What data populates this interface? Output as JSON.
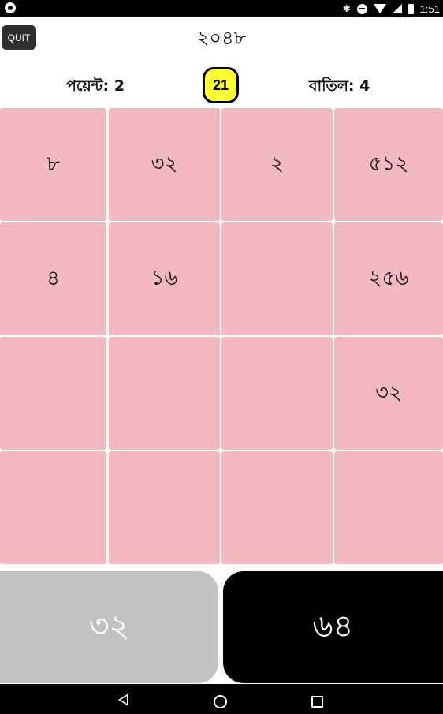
{
  "status_bar": {
    "time": "1:51",
    "icons": [
      "app-notification-icon",
      "bluetooth-icon",
      "do-not-disturb-icon",
      "wifi-icon",
      "cellular-icon",
      "battery-icon"
    ]
  },
  "header": {
    "quit_label": "QUIT",
    "title": "২০৪৮"
  },
  "score": {
    "points_label": "পয়েন্ট: 2",
    "counter": "21",
    "discard_label": "বাতিল: 4"
  },
  "board": {
    "rows": [
      [
        "৮",
        "৩২",
        "২",
        "৫১২"
      ],
      [
        "৪",
        "১৬",
        "",
        "২৫৬"
      ],
      [
        "",
        "",
        "",
        "৩২"
      ],
      [
        "",
        "",
        "",
        ""
      ]
    ],
    "tile_color": "#f3b9c1"
  },
  "next_tiles": {
    "left": "৩২",
    "right": "৬৪"
  },
  "colors": {
    "counter_bg": "#ffff33",
    "next_left_bg": "#c2c2c2",
    "next_right_bg": "#000000"
  }
}
